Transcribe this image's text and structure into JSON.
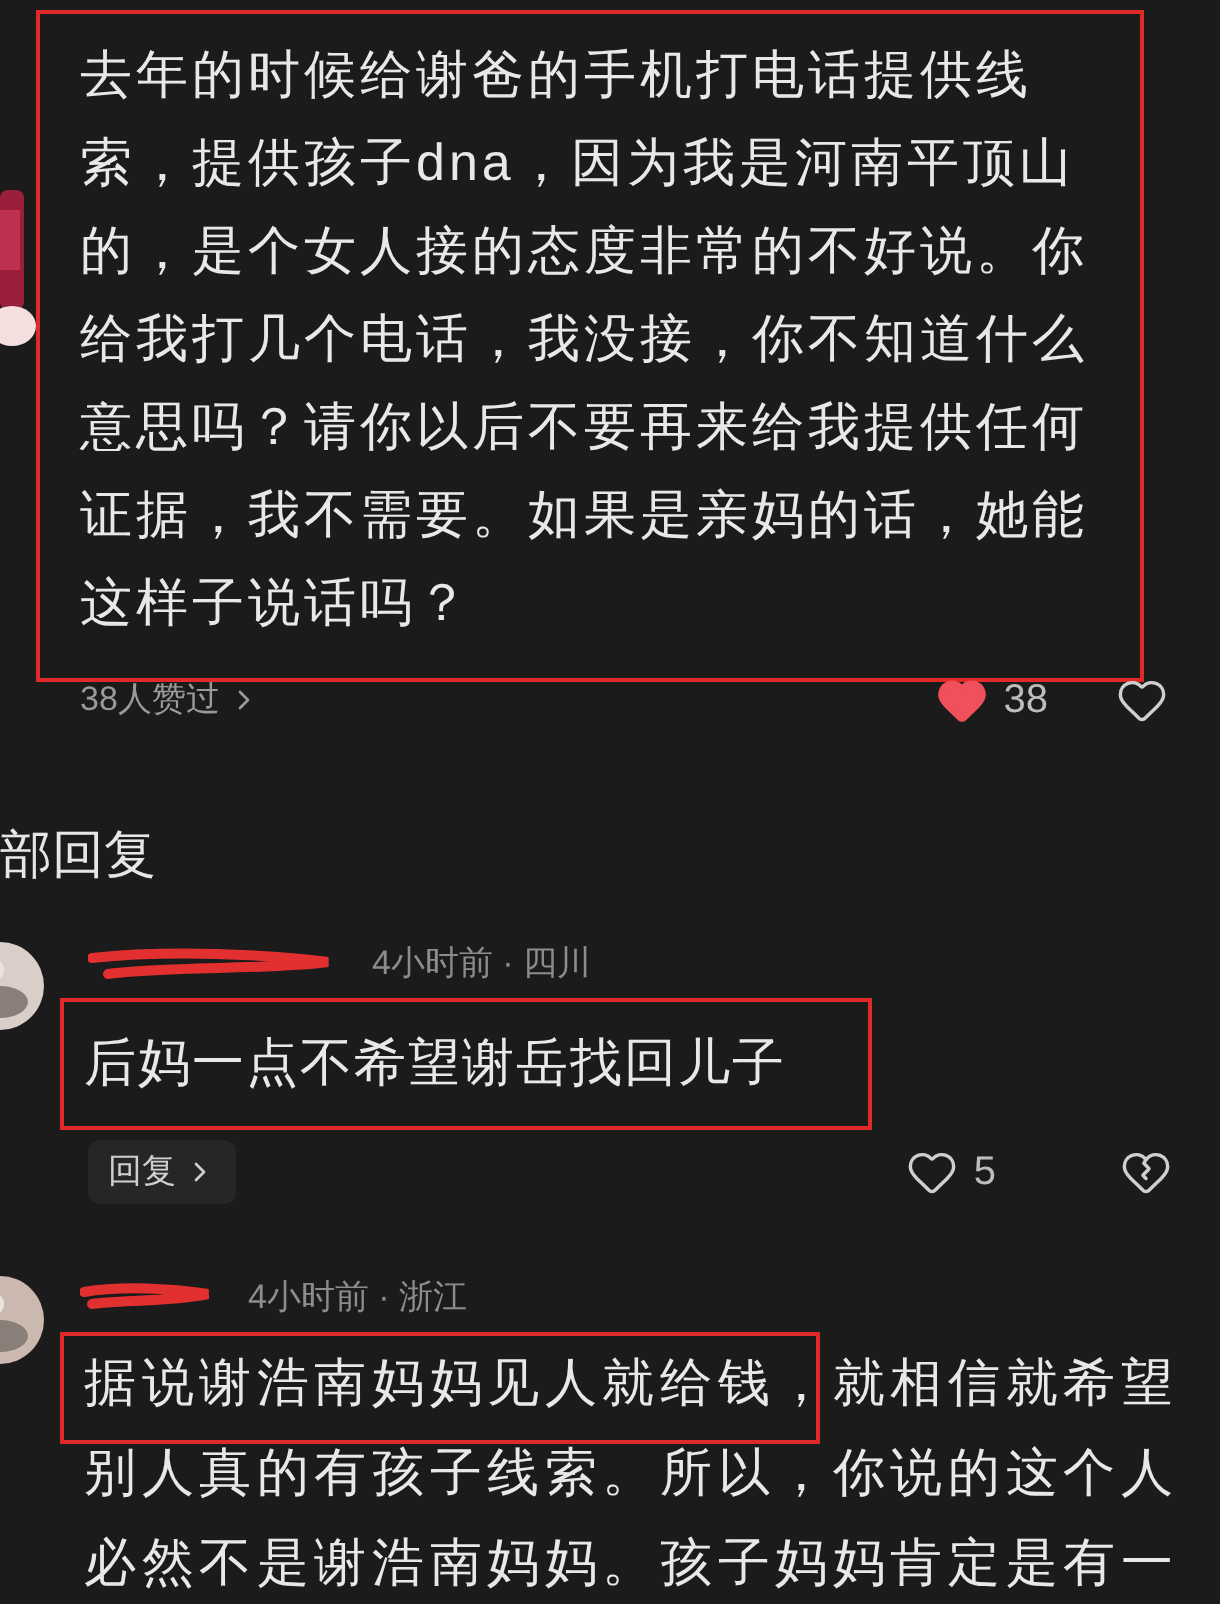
{
  "comment": {
    "text": "去年的时候给谢爸的手机打电话提供线索，提供孩子dna，因为我是河南平顶山的，是个女人接的态度非常的不好说。你给我打几个电话，我没接，你不知道什么意思吗？请你以后不要再来给我提供任何证据，我不需要。如果是亲妈的话，她能这样子说话吗？",
    "boxed": true,
    "likes_summary": "38人赞过",
    "like_count": "38",
    "liked": true
  },
  "section_title": "部回复",
  "replies": [
    {
      "time_location": "4小时前 · 四川",
      "text": "后妈一点不希望谢岳找回儿子",
      "boxed": true,
      "reply_label": "回复",
      "like_count": "5",
      "liked": false
    },
    {
      "time_location": "4小时前 · 浙江",
      "text": "据说谢浩南妈妈见人就给钱，就相信就希望别人真的有孩子线索。所以，你说的这个人必然不是谢浩南妈妈。孩子妈妈肯定是有一",
      "boxed": true
    }
  ]
}
